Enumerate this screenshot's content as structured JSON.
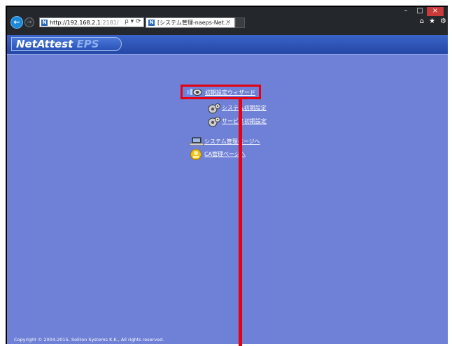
{
  "browser": {
    "url_host": "http://192.168.2.1",
    "url_rest": ":2181/",
    "addr_tools": "ρ ▾ ⟳",
    "tab_title": "[システム管理-naeps-Net...",
    "favicon_letter": "N",
    "tab_close": "×",
    "window_controls": {
      "minimize": "–",
      "maximize": "□",
      "close": "×"
    },
    "toolbar_icons": {
      "home": "⌂",
      "favorites": "★",
      "settings": "⚙"
    }
  },
  "header": {
    "logo_part1": "NetAttest",
    "logo_part2": " EPS"
  },
  "menu": {
    "wizard_label": "初期設定ウィザード",
    "system_init_label": "システム初期設定",
    "service_init_label": "サービス初期設定",
    "system_admin_label": "システム管理ページへ",
    "ca_admin_label": "CA管理ページへ"
  },
  "footer": {
    "copyright": "Copyright © 2004-2015, Soliton Systems K.K., All rights reserved."
  },
  "colors": {
    "content_bg": "#6f81d6",
    "header_bg": "#2447a6",
    "highlight": "#e60012"
  }
}
